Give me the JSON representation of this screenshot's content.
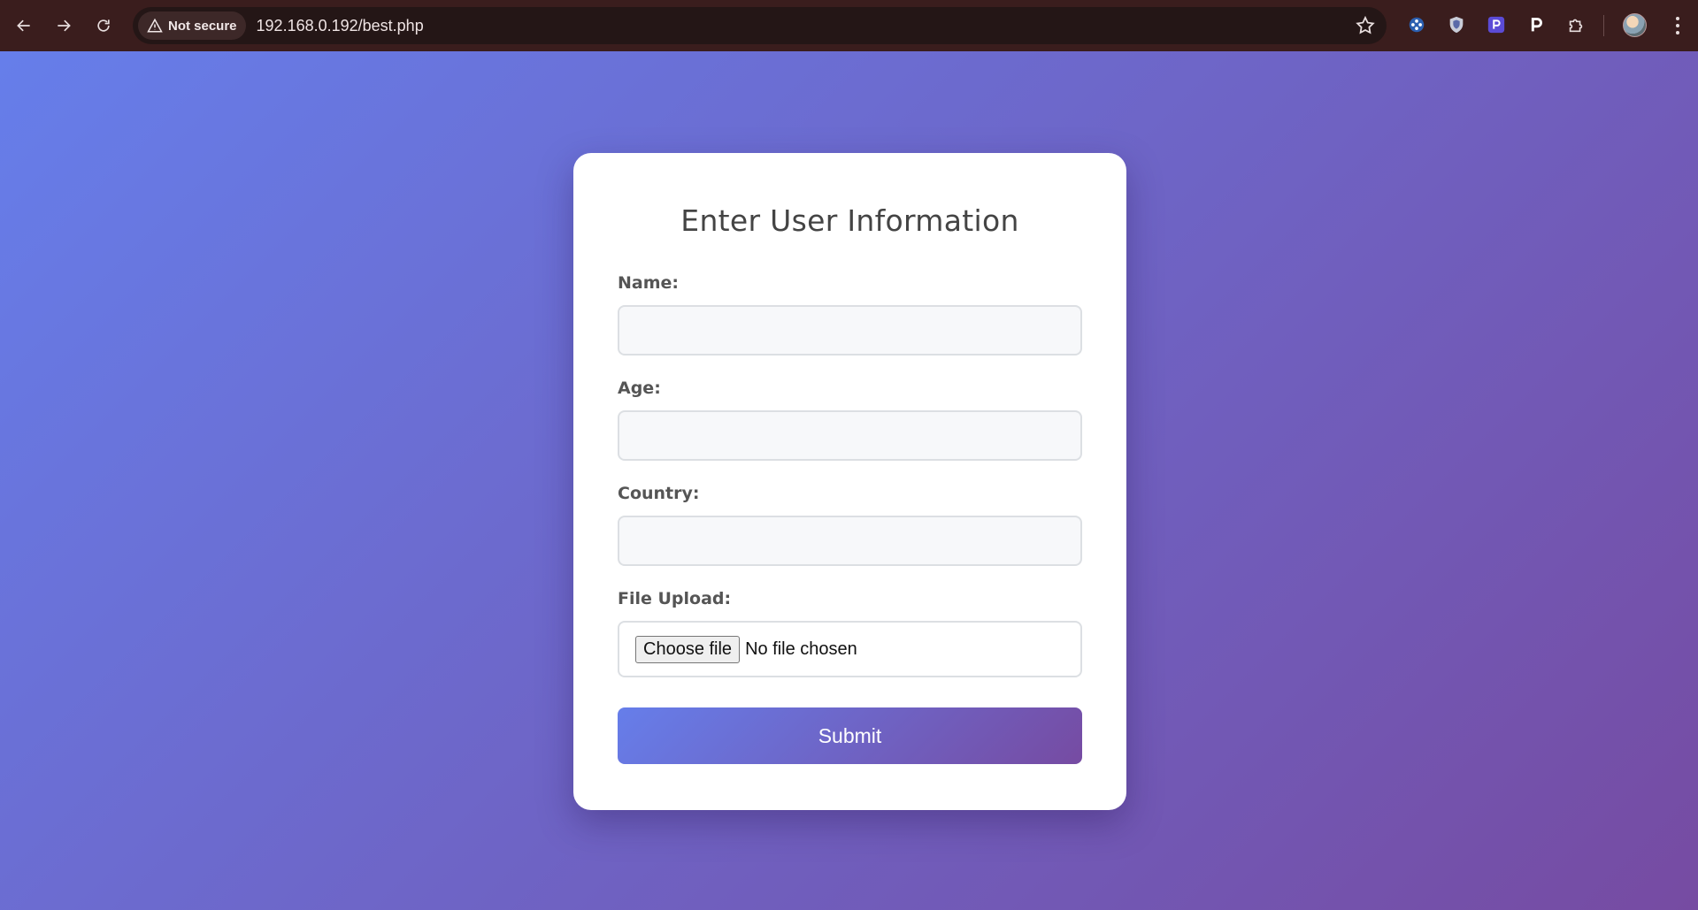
{
  "browser": {
    "security_label": "Not secure",
    "url": "192.168.0.192/best.php",
    "icons": {
      "back": "arrow-left-icon",
      "forward": "arrow-right-icon",
      "reload": "reload-icon",
      "security": "warning-triangle-icon",
      "bookmark": "star-icon",
      "extensions": [
        "extension-dots-icon",
        "shield-extension-icon",
        "p-badge-extension-icon",
        "p-extension-icon",
        "puzzle-icon"
      ],
      "menu": "kebab-menu-icon"
    }
  },
  "form": {
    "title": "Enter User Information",
    "fields": {
      "name": {
        "label": "Name:",
        "value": "",
        "placeholder": ""
      },
      "age": {
        "label": "Age:",
        "value": "",
        "placeholder": ""
      },
      "country": {
        "label": "Country:",
        "value": "",
        "placeholder": ""
      }
    },
    "file_upload": {
      "label": "File Upload:",
      "button_label": "Choose file",
      "status": "No file chosen"
    },
    "submit_label": "Submit"
  },
  "colors": {
    "gradient_start": "#667eea",
    "gradient_end": "#764ba2",
    "card_background": "#ffffff",
    "browser_frame": "#3a1d1d"
  }
}
